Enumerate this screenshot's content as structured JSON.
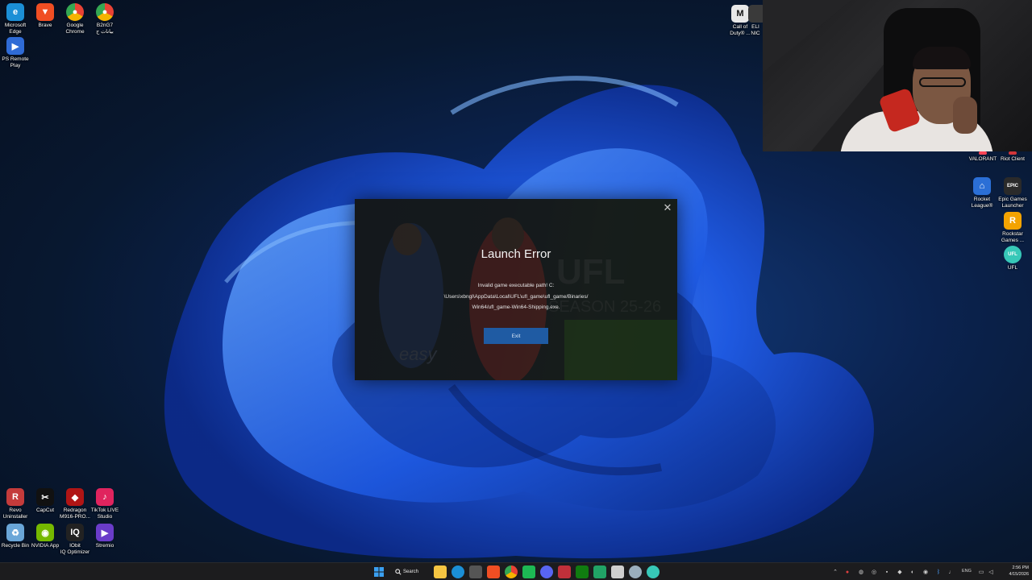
{
  "desktop": {
    "left_icons": [
      {
        "label": "Microsoft\nEdge",
        "icon": "edge-icon",
        "color": "#1b8fd6"
      },
      {
        "label": "Brave",
        "icon": "brave-icon",
        "color": "#f04e23"
      },
      {
        "label": "Google\nChrome",
        "icon": "chrome-icon",
        "color": "#e94235"
      },
      {
        "label": "B2nG7\nبيانات ج",
        "icon": "chrome-profile-icon",
        "color": "#f6b400"
      },
      {
        "label": "PS Remote\nPlay",
        "icon": "ps-remote-play-icon",
        "color": "#2f6bd6"
      }
    ],
    "top_right_icons": [
      {
        "label": "Call of\nDuty® ...",
        "icon": "call-of-duty-icon",
        "color": "#e8e8e8"
      },
      {
        "label": "ELI\nNIC",
        "icon": "partial-icon",
        "color": "#3a3a3a"
      }
    ],
    "right_icons": [
      {
        "label": "VALORANT",
        "icon": "valorant-icon",
        "color": "#fd4556"
      },
      {
        "label": "Riot Client",
        "icon": "riot-client-icon",
        "color": "#d13639"
      },
      {
        "label": "Rocket\nLeague®",
        "icon": "rocket-league-icon",
        "color": "#2b6fd6"
      },
      {
        "label": "Epic Games\nLauncher",
        "icon": "epic-games-icon",
        "color": "#2a2a2a"
      },
      {
        "label": "Rockstar\nGames ...",
        "icon": "rockstar-icon",
        "color": "#f4a300"
      },
      {
        "label": "UFL",
        "icon": "ufl-icon",
        "color": "#37c8b8"
      }
    ],
    "bottom_icons_row1": [
      {
        "label": "Revo\nUninstaller",
        "icon": "revo-uninstaller-icon",
        "color": "#c43b3b"
      },
      {
        "label": "CapCut",
        "icon": "capcut-icon",
        "color": "#111111"
      },
      {
        "label": "Redragon\nM916-PRO...",
        "icon": "redragon-icon",
        "color": "#b01515"
      },
      {
        "label": "TikTok LIVE\nStudio",
        "icon": "tiktok-live-icon",
        "color": "#e0245e"
      }
    ],
    "bottom_icons_row2": [
      {
        "label": "Recycle Bin",
        "icon": "recycle-bin-icon",
        "color": "#6aa6d8"
      },
      {
        "label": "NVIDIA App",
        "icon": "nvidia-icon",
        "color": "#76b900"
      },
      {
        "label": "IObit\nIQ Optimizer",
        "icon": "iq-optimizer-icon",
        "color": "#222222"
      },
      {
        "label": "Stremio",
        "icon": "stremio-icon",
        "color": "#6a3cc9"
      }
    ]
  },
  "dialog": {
    "title": "Launch Error",
    "message_line1": "Invalid game executable path! C:",
    "message_line2": "\\Users\\xbngl\\AppData\\Local\\UFL\\ufl_game\\ufl_game/Binaries/",
    "message_line3": "Win64/ufl_game-Win64-Shipping.exe.",
    "exit_label": "Exit",
    "close_glyph": "✕",
    "accent": "#1f5ba3"
  },
  "taskbar": {
    "search_label": "Search",
    "pinned": [
      {
        "name": "start-icon",
        "color": "#3aa0f2"
      },
      {
        "name": "file-explorer-icon",
        "color": "#f5c542"
      },
      {
        "name": "edge-icon",
        "color": "#1b8fd6"
      },
      {
        "name": "store-icon",
        "color": "#555555"
      },
      {
        "name": "brave-icon",
        "color": "#f04e23"
      },
      {
        "name": "chrome-icon",
        "color": "#e94235"
      },
      {
        "name": "spotify-icon",
        "color": "#1db954"
      },
      {
        "name": "discord-icon",
        "color": "#5865f2"
      },
      {
        "name": "app-red-icon",
        "color": "#c0303a"
      },
      {
        "name": "xbox-icon",
        "color": "#107c10"
      },
      {
        "name": "excel-icon",
        "color": "#21a366"
      },
      {
        "name": "notepad-icon",
        "color": "#cfcfcf"
      },
      {
        "name": "steam-icon",
        "color": "#9aaebd"
      },
      {
        "name": "ufl-taskbar-icon",
        "color": "#37c8b8"
      }
    ],
    "language": "ENG",
    "time": "2:56 PM",
    "date": "4/15/2026"
  }
}
